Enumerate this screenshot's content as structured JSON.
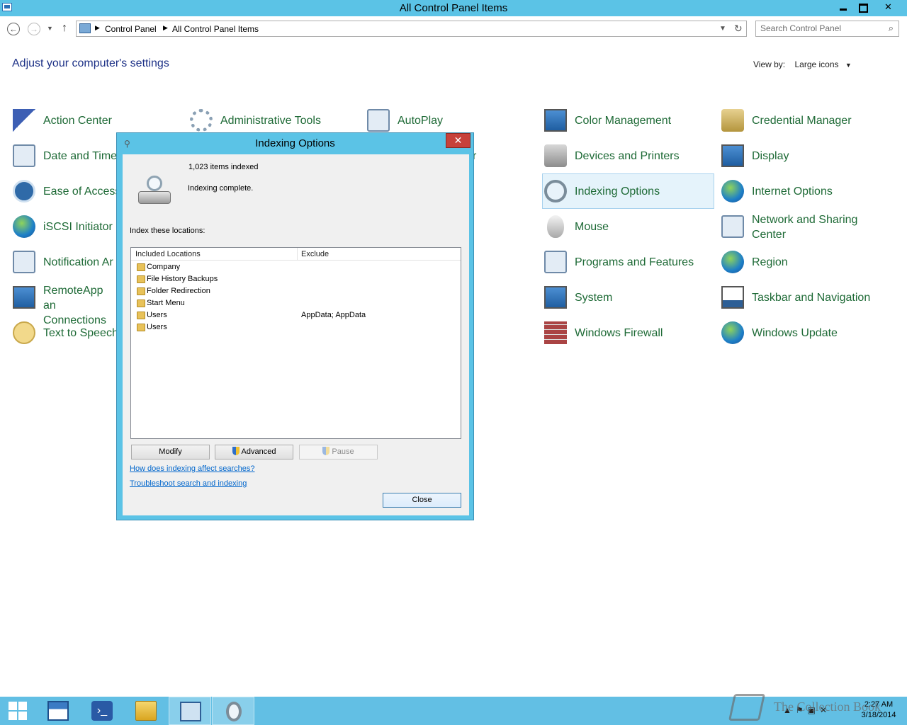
{
  "window": {
    "title": "All Control Panel Items"
  },
  "address_bar": {
    "breadcrumbs": [
      "Control Panel",
      "All Control Panel Items"
    ],
    "search_placeholder": "Search Control Panel"
  },
  "main": {
    "heading": "Adjust your computer's settings",
    "view_by_label": "View by:",
    "view_by_value": "Large icons",
    "items": [
      {
        "label": "Action Center",
        "icon": "flag-icon"
      },
      {
        "label": "Administrative Tools",
        "icon": "gear-icon"
      },
      {
        "label": "AutoPlay",
        "icon": "autoplay-icon"
      },
      {
        "label": "Color Management",
        "icon": "color-management-icon"
      },
      {
        "label": "Credential Manager",
        "icon": "vault-icon"
      },
      {
        "label": "Date and Time",
        "icon": "calendar-icon"
      },
      {
        "label": "r",
        "icon": ""
      },
      {
        "label": "Devices and Printers",
        "icon": "printer-icon"
      },
      {
        "label": "Display",
        "icon": "display-icon"
      },
      {
        "label": "Ease of Access",
        "icon": "ease-of-access-icon"
      },
      {
        "label": "Indexing Options",
        "icon": "indexing-icon"
      },
      {
        "label": "Internet Options",
        "icon": "globe-icon"
      },
      {
        "label": "iSCSI Initiator",
        "icon": "iscsi-icon"
      },
      {
        "label": "Mouse",
        "icon": "mouse-icon"
      },
      {
        "label": "Network and Sharing Center",
        "icon": "network-icon"
      },
      {
        "label": "Notification Ar",
        "icon": "notification-icon"
      },
      {
        "label": "Programs and Features",
        "icon": "programs-icon"
      },
      {
        "label": "Region",
        "icon": "region-icon"
      },
      {
        "label": "RemoteApp an Connections",
        "icon": "remoteapp-icon"
      },
      {
        "label": "System",
        "icon": "system-icon"
      },
      {
        "label": "Taskbar and Navigation",
        "icon": "taskbar-icon"
      },
      {
        "label": "Text to Speech",
        "icon": "speech-icon"
      },
      {
        "label": "Windows Firewall",
        "icon": "firewall-icon"
      },
      {
        "label": "Windows Update",
        "icon": "windows-update-icon"
      }
    ]
  },
  "dialog": {
    "title": "Indexing Options",
    "items_indexed": "1,023 items indexed",
    "status": "Indexing complete.",
    "locations_label": "Index these locations:",
    "columns": [
      "Included Locations",
      "Exclude"
    ],
    "rows": [
      {
        "name": "Company",
        "exclude": ""
      },
      {
        "name": "File History Backups",
        "exclude": ""
      },
      {
        "name": "Folder Redirection",
        "exclude": ""
      },
      {
        "name": "Start Menu",
        "exclude": ""
      },
      {
        "name": "Users",
        "exclude": "AppData; AppData"
      },
      {
        "name": "Users",
        "exclude": ""
      }
    ],
    "buttons": {
      "modify": "Modify",
      "advanced": "Advanced",
      "pause": "Pause",
      "close": "Close"
    },
    "links": {
      "how": "How does indexing affect searches?",
      "troubleshoot": "Troubleshoot search and indexing"
    }
  },
  "taskbar": {
    "time": "2:27 AM",
    "date": "3/18/2014",
    "watermark": "The Collection Book"
  }
}
